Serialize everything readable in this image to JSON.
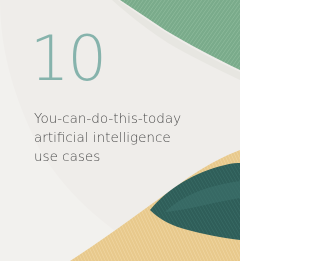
{
  "cover": {
    "number": "10",
    "subtitle_lines": [
      "You-can-do-this-today",
      "artificial intelligence",
      "use cases"
    ]
  },
  "colors": {
    "background": "#efedea",
    "number": "#86b3ac",
    "text": "#4a4a4a",
    "green_band": "#7fae8f",
    "sand_band": "#e9c98b",
    "teal_band": "#2f5f5a"
  }
}
